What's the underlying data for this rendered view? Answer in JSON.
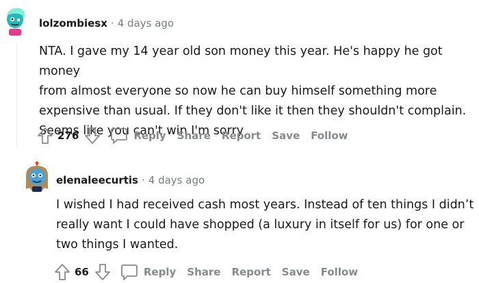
{
  "comments": [
    {
      "username": "lolzombiesx",
      "separator": "·",
      "time": "4 days ago",
      "lines": [
        "NTA. I gave my 14 year old son money this year. He's happy he got money",
        "from almost everyone so now he can buy himself something more",
        "expensive than usual. If they don't like it then they shouldn't complain.",
        "Seems like you can't win I'm sorry"
      ],
      "score": "276",
      "actions": {
        "reply": "Reply",
        "share": "Share",
        "report": "Report",
        "save": "Save",
        "follow": "Follow"
      }
    },
    {
      "username": "elenaleecurtis",
      "separator": "·",
      "time": "4 days ago",
      "lines": [
        "I wished I had received cash most years. Instead of ten things I didn’t",
        "really want I could have shopped (a luxury in itself for us) for one or",
        "two things I wanted."
      ],
      "score": "66",
      "actions": {
        "reply": "Reply",
        "share": "Share",
        "report": "Report",
        "save": "Save",
        "follow": "Follow"
      }
    }
  ],
  "colors": {
    "meta": "#787c7e",
    "action": "#878a8c",
    "text": "#1a1a1b",
    "thread_line": "#edeff1"
  },
  "icons": [
    "upvote-icon",
    "downvote-icon",
    "comment-bubble-icon"
  ]
}
